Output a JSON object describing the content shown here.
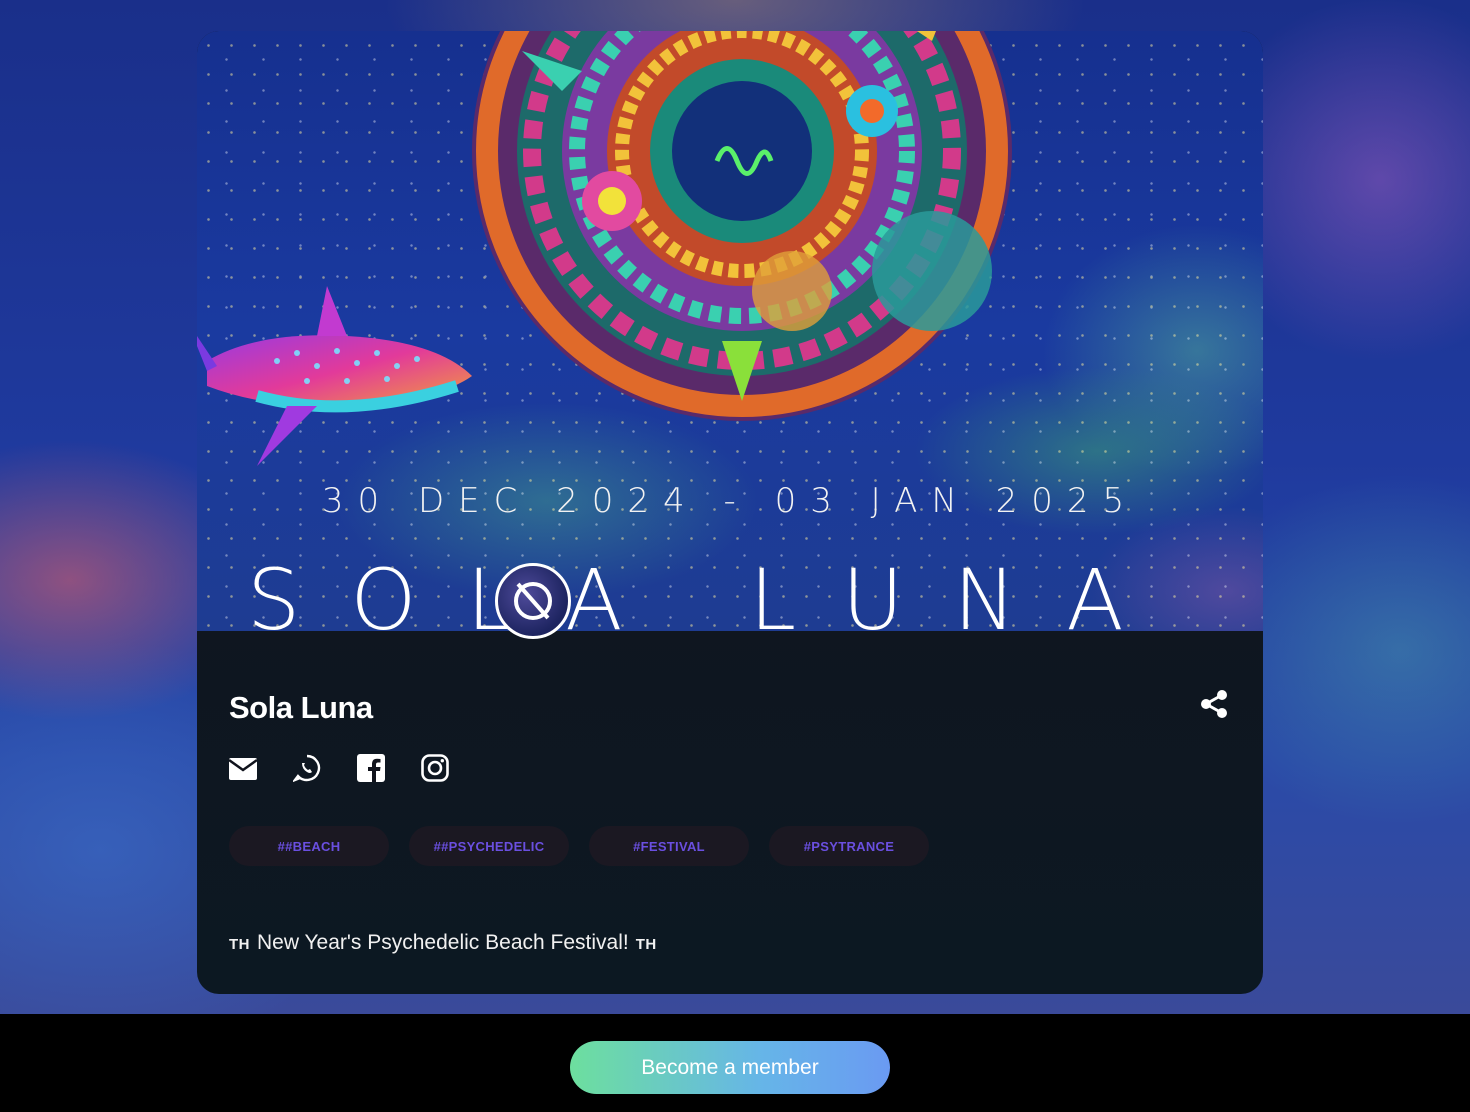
{
  "banner": {
    "dates": "30 DEC 2024 - 03 JAN 2025",
    "title": "SOLA LUNA"
  },
  "club": {
    "name": "Sola Luna",
    "description": "New Year's Psychedelic Beach Festival!",
    "description_prefix": "TH",
    "description_suffix": "TH"
  },
  "socials": [
    {
      "icon": "mail-icon"
    },
    {
      "icon": "whatsapp-icon"
    },
    {
      "icon": "facebook-icon"
    },
    {
      "icon": "instagram-icon"
    }
  ],
  "tags": [
    "##BEACH",
    "##PSYCHEDELIC",
    "#FESTIVAL",
    "#PSYTRANCE"
  ],
  "actions": {
    "member_label": "Become a member",
    "share_icon": "share-icon"
  },
  "colors": {
    "tag_text": "#6a4fe0",
    "tag_bg": "#1b1822",
    "button_gradient_start": "#6ddf9e",
    "button_gradient_end": "#6a9af2"
  }
}
